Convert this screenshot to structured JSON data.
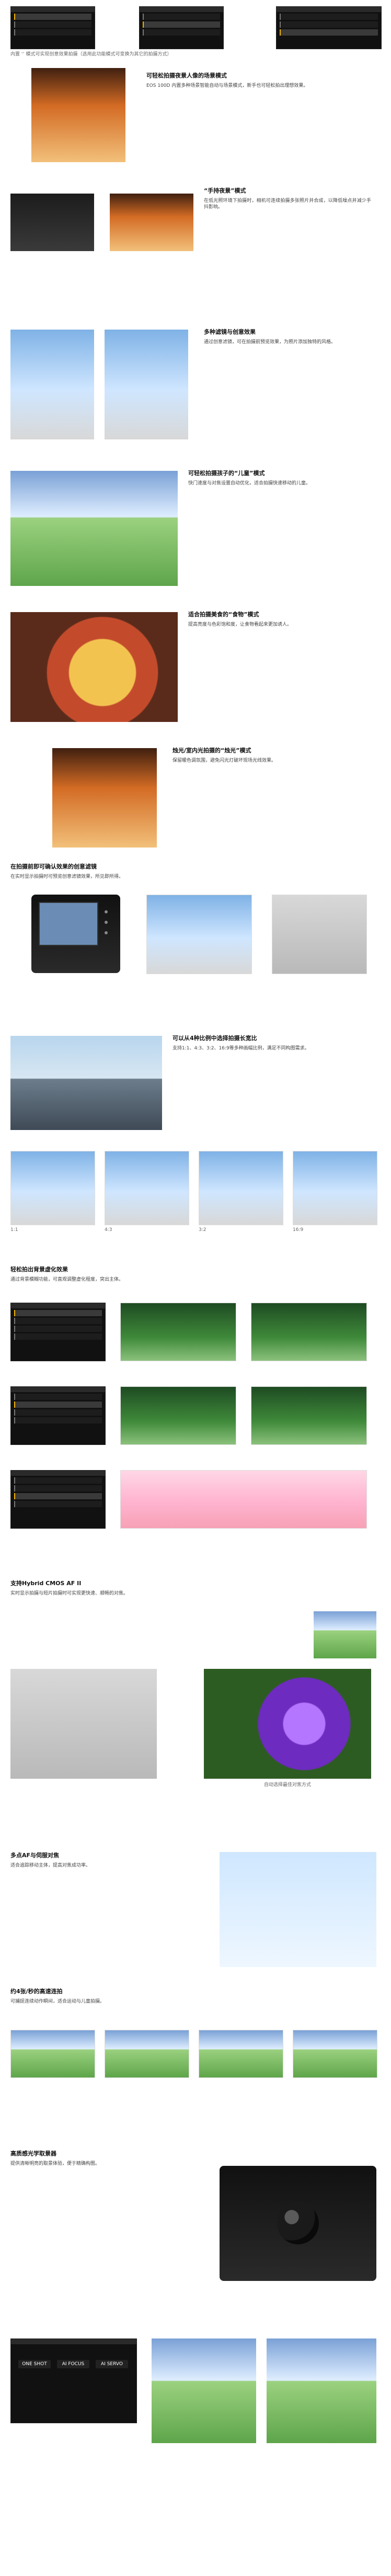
{
  "top": {
    "caption": "内置 ‘‘ 模式可实现创意效果拍摄（选用此功能模式可变换为其它的拍摄方式）"
  },
  "sections": [
    {
      "title": "可轻松拍摄夜景人像的场景模式",
      "body": "EOS 100D 内置多种场景智能自动与场景模式，新手也可轻松拍出理想效果。"
    },
    {
      "title": "“手持夜景”模式",
      "body": "在低光照环境下拍摄时，相机可连续拍摄多张照片并合成，以降低噪点并减少手抖影响。"
    },
    {
      "title": "多种滤镜与创意效果",
      "body": "通过创意滤镜，可在拍摄前预览效果，为照片添加独特的风格。"
    },
    {
      "title": "可轻松拍摄孩子的“儿童”模式",
      "body": "快门速度与对焦设置自动优化，适合拍摄快速移动的儿童。"
    },
    {
      "title": "适合拍摄美食的“食物”模式",
      "body": "提高亮度与色彩饱和度，让食物看起来更加诱人。"
    },
    {
      "title": "烛光/室内光拍摄的“烛光”模式",
      "body": "保留暖色调氛围，避免闪光灯破坏现场光线效果。"
    },
    {
      "title": "在拍摄前即可确认效果的创意滤镜",
      "body": "在实时显示拍摄时可预览创意滤镜效果，所见即所得。"
    },
    {
      "title": "可以从4种比例中选择拍摄长宽比",
      "body": "支持1:1、4:3、3:2、16:9等多种画幅比例，满足不同构图需求。"
    },
    {
      "title": "轻松拍出背景虚化效果",
      "body": "通过背景模糊功能，可直观调整虚化程度，突出主体。"
    },
    {
      "title": "支持Hybrid CMOS AF II",
      "body": "实时显示拍摄与短片拍摄时可实现更快速、顺畅的对焦。"
    },
    {
      "title": "多点AF与伺服对焦",
      "body": "适合追踪移动主体，提高对焦成功率。"
    },
    {
      "title": "约4张/秒的高速连拍",
      "body": "可捕捉连续动作瞬间，适合运动与儿童拍摄。"
    },
    {
      "title": "高质感光学取景器",
      "body": "提供清晰明亮的取景体验，便于精确构图。"
    }
  ],
  "menu_items": [
    "拍摄模式",
    "画质",
    "创意滤镜",
    "长宽比",
    "背景模糊",
    "AF方式"
  ],
  "aspect_labels": [
    "1:1",
    "4:3",
    "3:2",
    "16:9"
  ],
  "af_modes": [
    "ONE SHOT",
    "AI FOCUS",
    "AI SERVO"
  ],
  "footer_caption": "自动选择最佳对焦方式"
}
